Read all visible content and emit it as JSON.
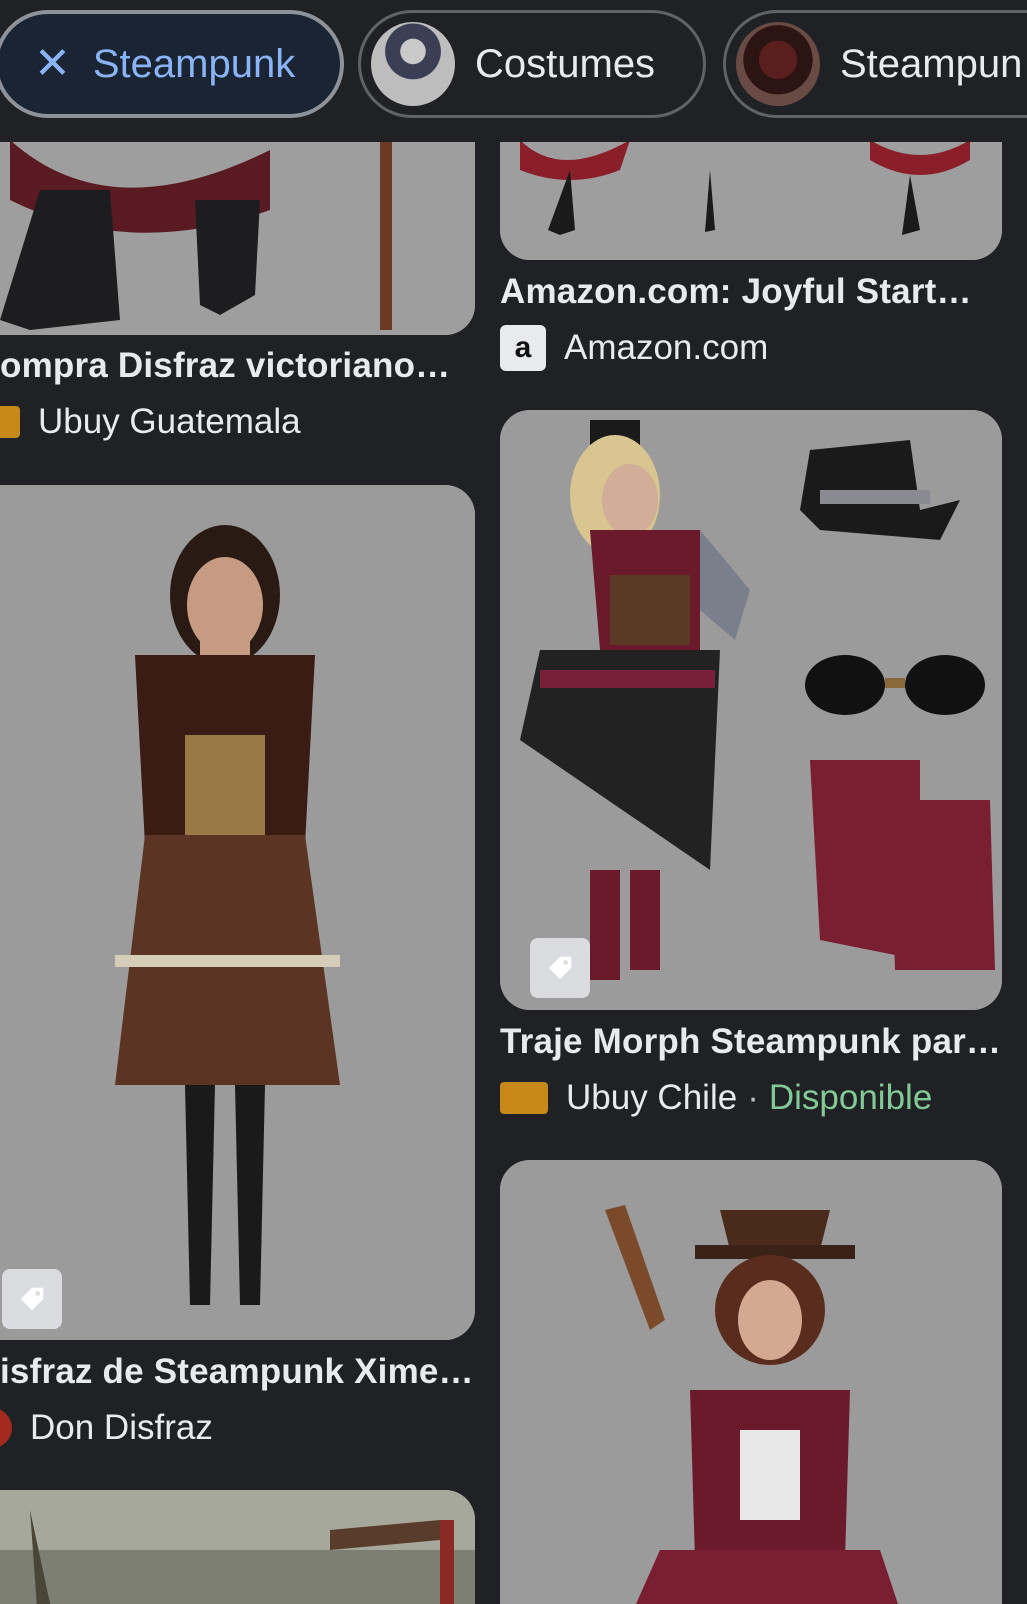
{
  "chips": [
    {
      "label": "Steampunk",
      "active": true,
      "close_icon": "close-icon"
    },
    {
      "label": "Costumes",
      "active": false
    },
    {
      "label": "Steampun",
      "active": false
    }
  ],
  "results": [
    {
      "title": "ompra Disfraz victoriano…",
      "source": "Ubuy Guatemala"
    },
    {
      "title": "Amazon.com: Joyful Start…",
      "source": "Amazon.com"
    },
    {
      "title": "isfraz de Steampunk Xime…",
      "source": "Don Disfraz"
    },
    {
      "title": "Traje Morph Steampunk par…",
      "source": "Ubuy Chile",
      "availability": "Disponible"
    }
  ],
  "colors": {
    "background": "#202124",
    "active_chip_text": "#8ab4f8",
    "available": "#81c995"
  }
}
